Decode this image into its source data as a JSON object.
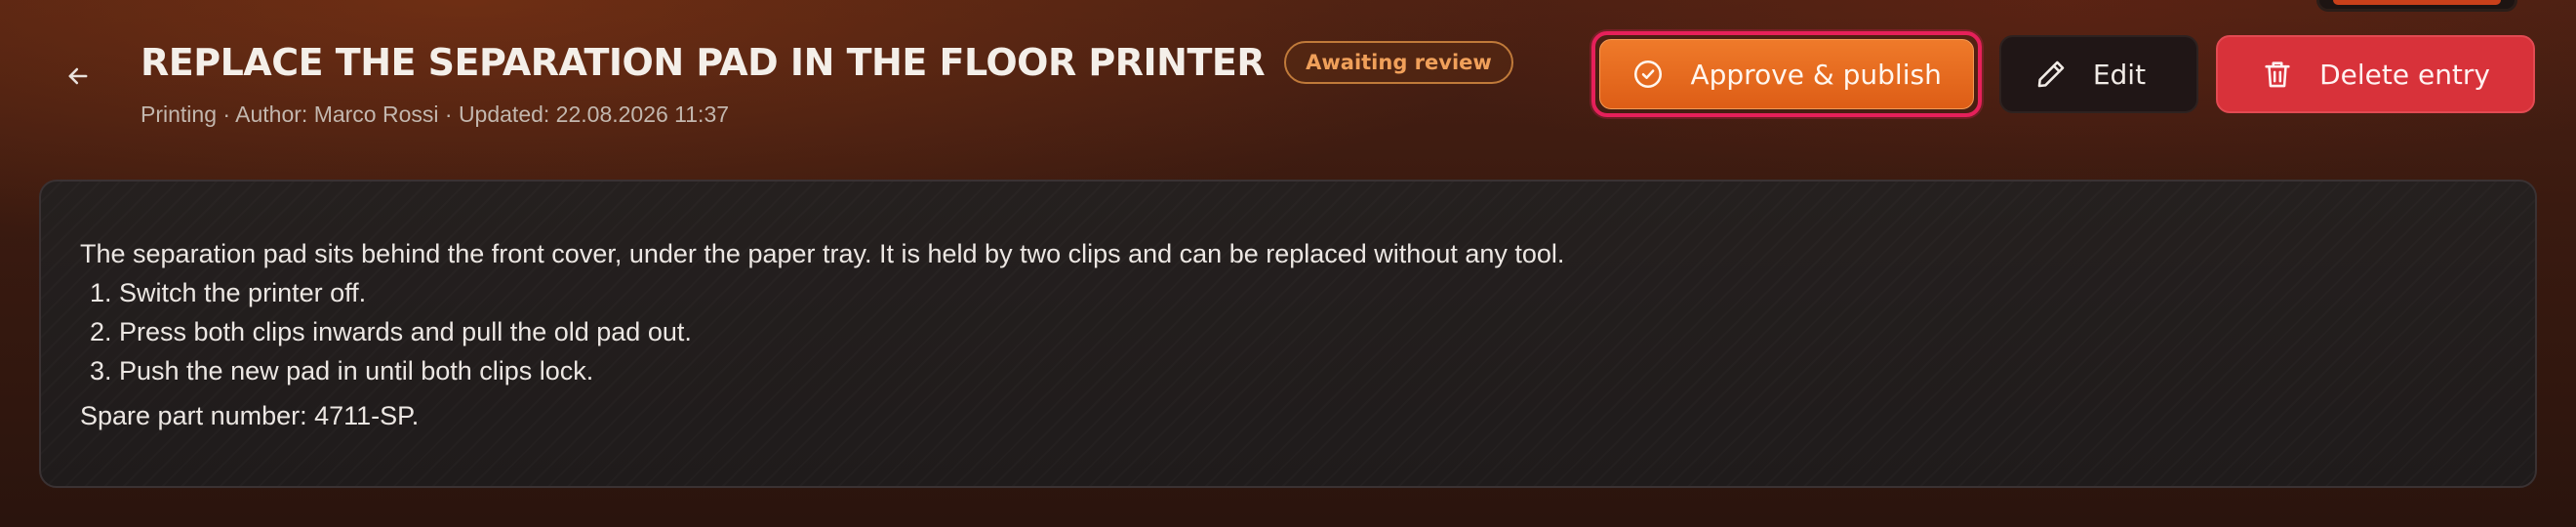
{
  "header": {
    "back_icon": "arrow-left-icon",
    "title": "REPLACE THE SEPARATION PAD IN THE FLOOR PRINTER",
    "status": "Awaiting review",
    "meta": "Printing · Author: Marco Rossi · Updated: 22.08.2026 11:37"
  },
  "actions": {
    "approve": {
      "label": "Approve & publish",
      "icon": "check-circle-icon"
    },
    "edit": {
      "label": "Edit",
      "icon": "pencil-icon"
    },
    "delete": {
      "label": "Delete entry",
      "icon": "trash-icon"
    }
  },
  "content": {
    "intro": "The separation pad sits behind the front cover, under the paper tray. It is held by two clips and can be replaced without any tool.",
    "steps": [
      "Switch the printer off.",
      "Press both clips inwards and pull the old pad out.",
      "Push the new pad in until both clips lock."
    ],
    "spare_part": "Spare part number: 4711-SP."
  },
  "colors": {
    "accent_orange": "#e8691e",
    "danger_red": "#d8323a",
    "focus_ring": "#e6205a",
    "badge_orange": "#f0a05a"
  }
}
